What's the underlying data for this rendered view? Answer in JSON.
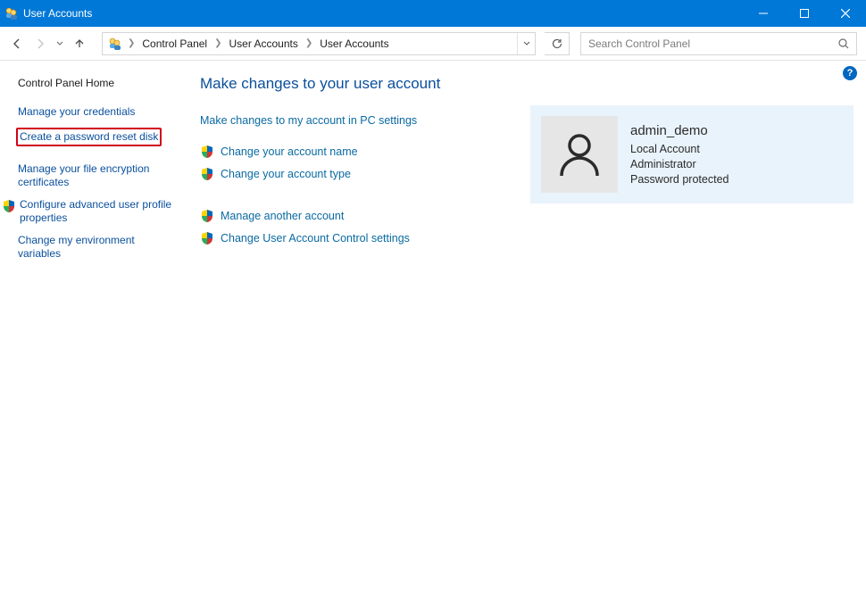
{
  "window": {
    "title": "User Accounts"
  },
  "breadcrumb": {
    "items": [
      "Control Panel",
      "User Accounts",
      "User Accounts"
    ]
  },
  "search": {
    "placeholder": "Search Control Panel"
  },
  "sidebar": {
    "home": "Control Panel Home",
    "links": {
      "credentials": "Manage your credentials",
      "reset_disk": "Create a password reset disk",
      "encryption": "Manage your file encryption certificates",
      "advanced_profile": "Configure advanced user profile properties",
      "env_vars": "Change my environment variables"
    }
  },
  "main": {
    "heading": "Make changes to your user account",
    "pc_settings": "Make changes to my account in PC settings",
    "change_name": "Change your account name",
    "change_type": "Change your account type",
    "manage_another": "Manage another account",
    "uac": "Change User Account Control settings"
  },
  "usercard": {
    "name": "admin_demo",
    "type": "Local Account",
    "role": "Administrator",
    "pw": "Password protected"
  },
  "help": {
    "symbol": "?"
  }
}
